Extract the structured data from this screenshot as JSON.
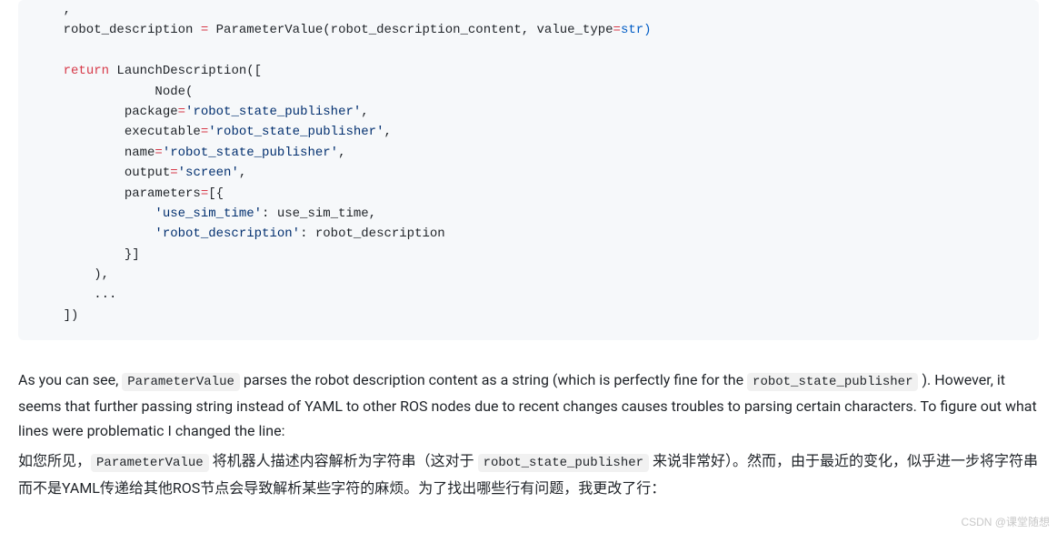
{
  "code": {
    "t01": "    ,",
    "t02a": "    robot_description ",
    "t02b": "=",
    "t02c": " ParameterValue",
    "t02d": "(robot_description_content, value_type",
    "t02e": "=",
    "t02f": "str)",
    "t03": "",
    "t04a": "    ",
    "t04b": "return",
    "t04c": " LaunchDescription([",
    "t05": "                Node(",
    "t06a": "            package",
    "t06b": "=",
    "t06c": "'robot_state_publisher'",
    "t06d": ",",
    "t07a": "            executable",
    "t07b": "=",
    "t07c": "'robot_state_publisher'",
    "t07d": ",",
    "t08a": "            name",
    "t08b": "=",
    "t08c": "'robot_state_publisher'",
    "t08d": ",",
    "t09a": "            output",
    "t09b": "=",
    "t09c": "'screen'",
    "t09d": ",",
    "t10a": "            parameters",
    "t10b": "=",
    "t10c": "[{",
    "t11a": "                ",
    "t11b": "'use_sim_time'",
    "t11c": ": use_sim_time,",
    "t12a": "                ",
    "t12b": "'robot_description'",
    "t12c": ": robot_description",
    "t13": "            }]",
    "t14": "        ),",
    "t15": "        ...",
    "t16": "    ])"
  },
  "para1": {
    "pre1": "As you can see, ",
    "code1": "ParameterValue",
    "mid1": " parses the robot description content as a string (which is perfectly fine for the ",
    "code2": "robot_state_publisher",
    "post1": " ). However, it seems that further passing string instead of YAML to other ROS nodes due to recent changes causes troubles to parsing certain characters. To figure out what lines were problematic I changed the line:"
  },
  "para2": {
    "pre1": "如您所见，",
    "code1": "ParameterValue",
    "mid1": " 将机器人描述内容解析为字符串（这对于 ",
    "code2": "robot_state_publisher",
    "post1": " 来说非常好）。然而，由于最近的变化，似乎进一步将字符串而不是YAML传递给其他ROS节点会导致解析某些字符的麻烦。为了找出哪些行有问题，我更改了行："
  },
  "watermark": "CSDN @课堂随想"
}
